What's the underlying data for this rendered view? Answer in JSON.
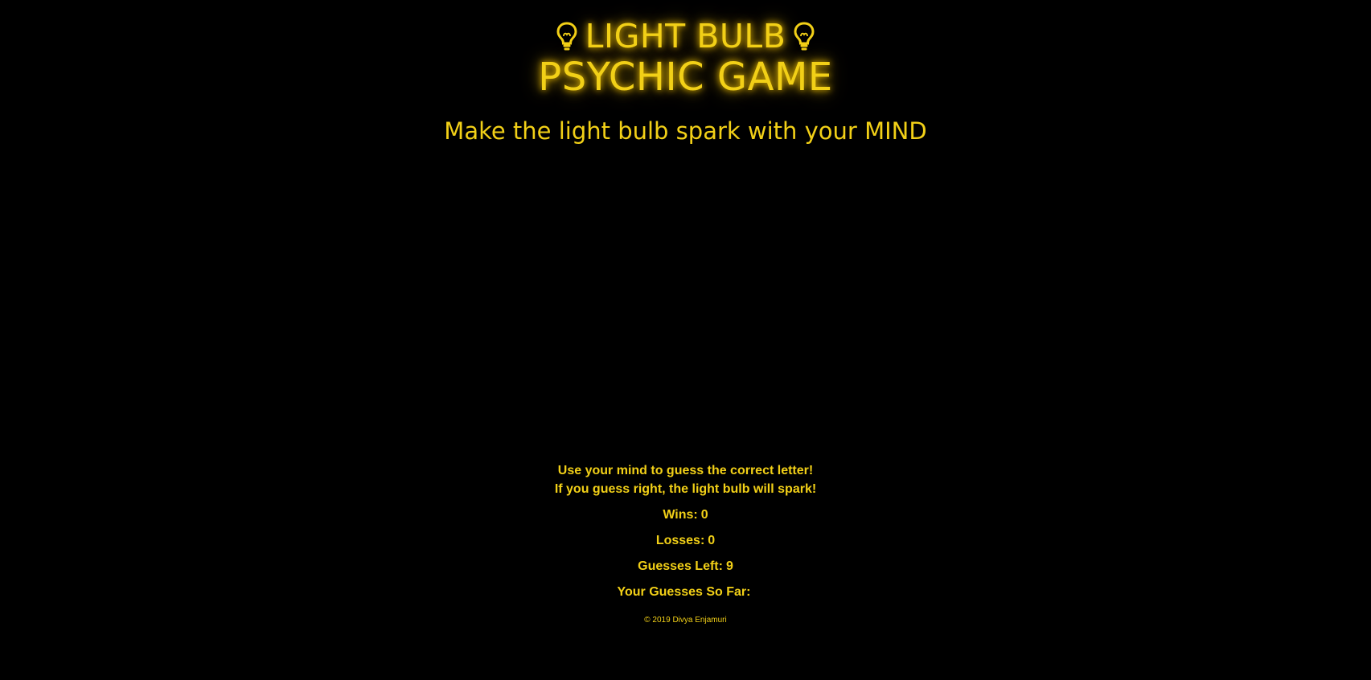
{
  "header": {
    "title_line1": "LIGHT BULB",
    "title_line2": "PSYCHIC GAME",
    "tagline": "Make the light bulb spark with your MIND"
  },
  "instructions": {
    "line1": "Use your mind to guess the correct letter!",
    "line2": "If you guess right, the light bulb will spark!"
  },
  "stats": {
    "wins_label": "Wins:",
    "wins_value": "0",
    "losses_label": "Losses:",
    "losses_value": "0",
    "guesses_left_label": "Guesses Left:",
    "guesses_left_value": "9",
    "guesses_so_far_label": "Your Guesses So Far:",
    "guesses_so_far_value": ""
  },
  "footer": {
    "copyright": "© 2019 Divya Enjamuri"
  },
  "icons": {
    "title_left": "light-bulb-icon",
    "title_right": "light-bulb-icon"
  },
  "colors": {
    "background": "#000000",
    "accent": "#f2d017",
    "glow": "#e6b800"
  }
}
